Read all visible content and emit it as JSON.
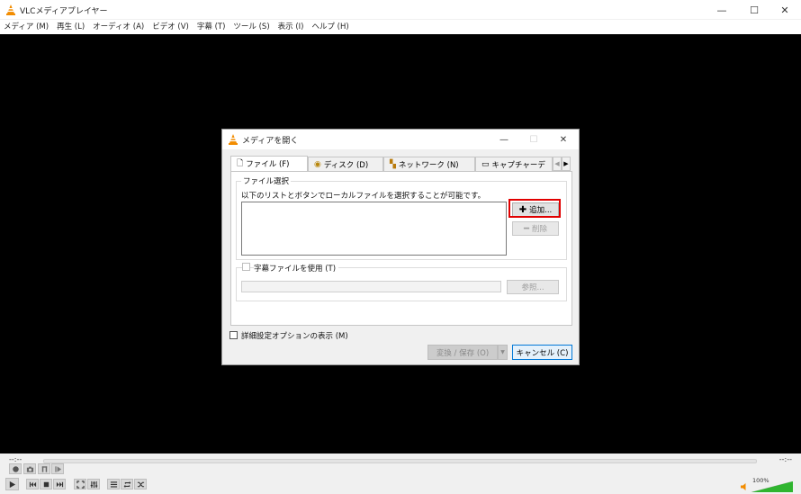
{
  "window": {
    "title": "VLCメディアプレイヤー",
    "minimize": "—",
    "maximize": "☐",
    "close": "✕"
  },
  "menu": [
    "メディア (M)",
    "再生 (L)",
    "オーディオ (A)",
    "ビデオ (V)",
    "字幕 (T)",
    "ツール (S)",
    "表示 (I)",
    "ヘルプ (H)"
  ],
  "controls": {
    "time_elapsed": "--:--",
    "time_total": "--:--",
    "volume": "100%",
    "volume_level": 1.0
  },
  "dialog": {
    "title": "メディアを開く",
    "minimize": "—",
    "maximize": "☐",
    "close": "✕",
    "tabs": [
      {
        "label": "ファイル (F)",
        "icon": "file-icon",
        "active": true
      },
      {
        "label": "ディスク (D)",
        "icon": "disc-icon",
        "active": false
      },
      {
        "label": "ネットワーク (N)",
        "icon": "network-icon",
        "active": false
      },
      {
        "label": "キャプチャーデ",
        "icon": "capture-icon",
        "active": false
      }
    ],
    "file_selection": {
      "group_label": "ファイル選択",
      "description": "以下のリストとボタンでローカルファイルを選択することが可能です。",
      "add_button": "追加...",
      "remove_button": "削除"
    },
    "subtitle": {
      "checkbox_label": "字幕ファイルを使用 (T)",
      "checked": false,
      "browse_button": "参照..."
    },
    "show_options_label": "詳細設定オプションの表示 (M)",
    "show_options_checked": false,
    "convert_button": "変換 / 保存 (O)",
    "cancel_button": "キャンセル (C)"
  },
  "colors": {
    "highlight": "#e10000",
    "vlc_orange": "#f28c00",
    "cancel_border": "#0078d7"
  }
}
